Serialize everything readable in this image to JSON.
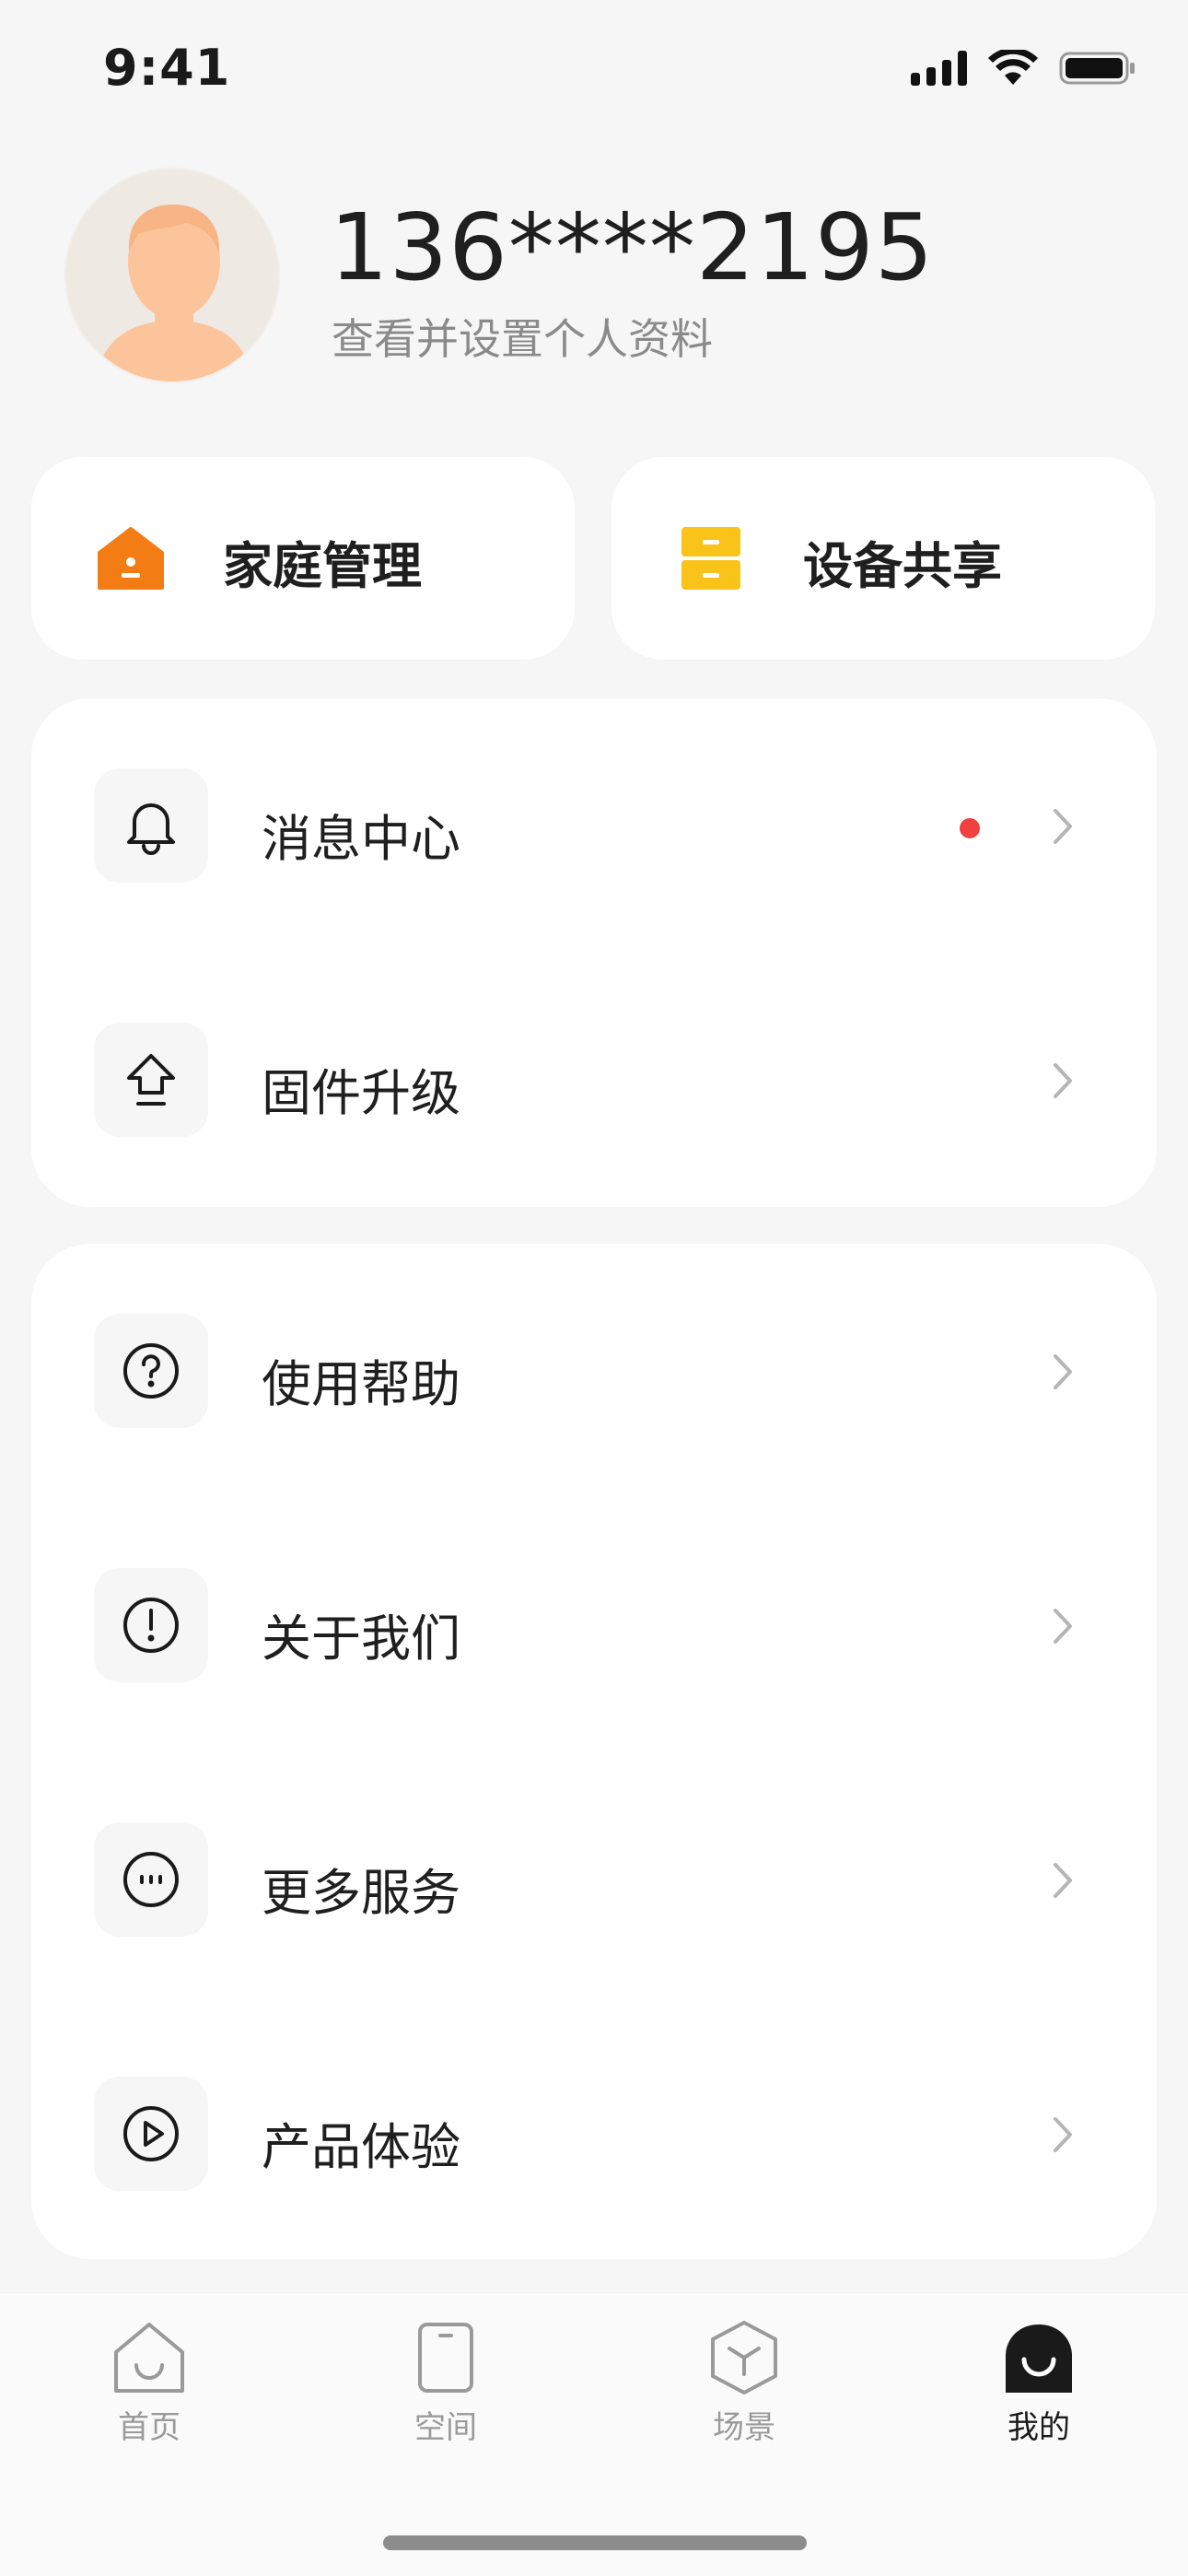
{
  "status_bar": {
    "time": "9:41"
  },
  "profile": {
    "name": "136****2195",
    "subtitle": "查看并设置个人资料"
  },
  "quick_actions": [
    {
      "label": "家庭管理",
      "icon": "house-icon",
      "color": "#f47c15"
    },
    {
      "label": "设备共享",
      "icon": "share-drawer-icon",
      "color": "#fac31a"
    }
  ],
  "menu_group_1": [
    {
      "label": "消息中心",
      "icon": "bell-icon",
      "has_notification": true
    },
    {
      "label": "固件升级",
      "icon": "upgrade-arrow-icon",
      "has_notification": false
    }
  ],
  "menu_group_2": [
    {
      "label": "使用帮助",
      "icon": "question-circle-icon"
    },
    {
      "label": "关于我们",
      "icon": "exclamation-circle-icon"
    },
    {
      "label": "更多服务",
      "icon": "more-circle-icon"
    },
    {
      "label": "产品体验",
      "icon": "play-circle-icon"
    }
  ],
  "tabbar": {
    "items": [
      {
        "label": "首页",
        "icon": "home-tab-icon"
      },
      {
        "label": "空间",
        "icon": "space-tab-icon"
      },
      {
        "label": "场景",
        "icon": "scene-tab-icon"
      },
      {
        "label": "我的",
        "icon": "profile-tab-icon"
      }
    ],
    "active": "我的"
  },
  "colors": {
    "notification_dot": "#f04040",
    "background": "#f6f6f6"
  }
}
